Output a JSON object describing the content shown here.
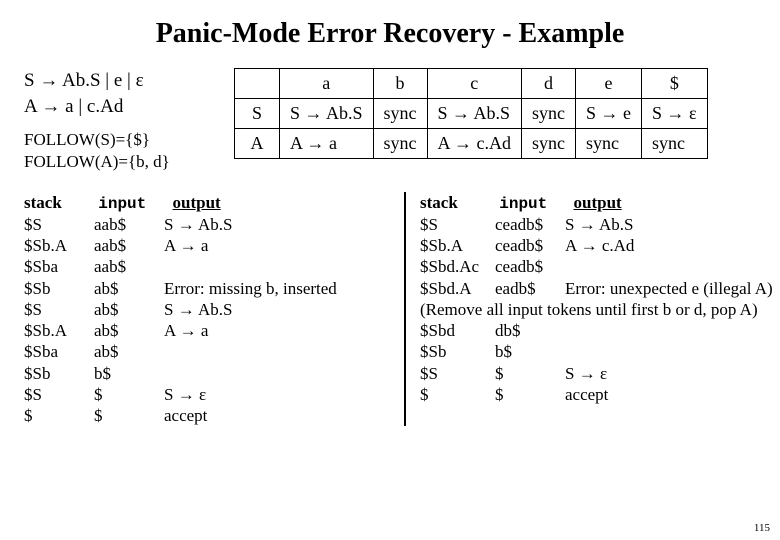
{
  "title": "Panic-Mode Error Recovery - Example",
  "grammar": {
    "line1": "S → Ab.S  |  e  |  ε",
    "line2": "A → a  |  c.Ad"
  },
  "follow": {
    "line1": "FOLLOW(S)={$}",
    "line2": "FOLLOW(A)={b, d}"
  },
  "table": {
    "cols": [
      "a",
      "b",
      "c",
      "d",
      "e",
      "$"
    ],
    "rows": [
      {
        "head": "S",
        "cells": [
          "S → Ab.S",
          "sync",
          "S → Ab.S",
          "sync",
          "S → e",
          "S → ε"
        ]
      },
      {
        "head": "A",
        "cells": [
          "A → a",
          "sync",
          "A → c.Ad",
          "sync",
          "sync",
          "sync"
        ]
      }
    ]
  },
  "traceLeft": {
    "headers": {
      "stack": "stack",
      "input": "input",
      "output": "output"
    },
    "rows": [
      {
        "stack": "$S",
        "input": "aab$",
        "output": "S → Ab.S"
      },
      {
        "stack": "$Sb.A",
        "input": "aab$",
        "output": "A → a"
      },
      {
        "stack": "$Sba",
        "input": "aab$",
        "output": ""
      },
      {
        "stack": "$Sb",
        "input": "ab$",
        "output": "Error: missing b, inserted"
      },
      {
        "stack": "$S",
        "input": "ab$",
        "output": "S → Ab.S"
      },
      {
        "stack": "$Sb.A",
        "input": "ab$",
        "output": "A → a"
      },
      {
        "stack": "$Sba",
        "input": "ab$",
        "output": ""
      },
      {
        "stack": "$Sb",
        "input": "b$",
        "output": ""
      },
      {
        "stack": "$S",
        "input": "$",
        "output": "S → ε"
      },
      {
        "stack": "$",
        "input": "$",
        "output": "accept"
      }
    ]
  },
  "traceRight": {
    "headers": {
      "stack": "stack",
      "input": "input",
      "output": "output"
    },
    "rows": [
      {
        "stack": "$S",
        "input": "ceadb$",
        "output": " S → Ab.S"
      },
      {
        "stack": "$Sb.A",
        "input": "ceadb$",
        "output": " A → c.Ad"
      },
      {
        "stack": "$Sbd.Ac",
        "input": "ceadb$",
        "output": ""
      },
      {
        "stack": "$Sbd.A",
        "input": "eadb$",
        "output": "Error: unexpected e (illegal A)"
      }
    ],
    "note": "(Remove all input tokens until first b or d, pop A)",
    "rows2": [
      {
        "stack": "$Sbd",
        "input": "db$",
        "output": ""
      },
      {
        "stack": "$Sb",
        "input": "b$",
        "output": ""
      },
      {
        "stack": "$S",
        "input": "$",
        "output": "S → ε"
      },
      {
        "stack": "$",
        "input": "$",
        "output": "accept"
      }
    ]
  },
  "pageNumber": "115"
}
